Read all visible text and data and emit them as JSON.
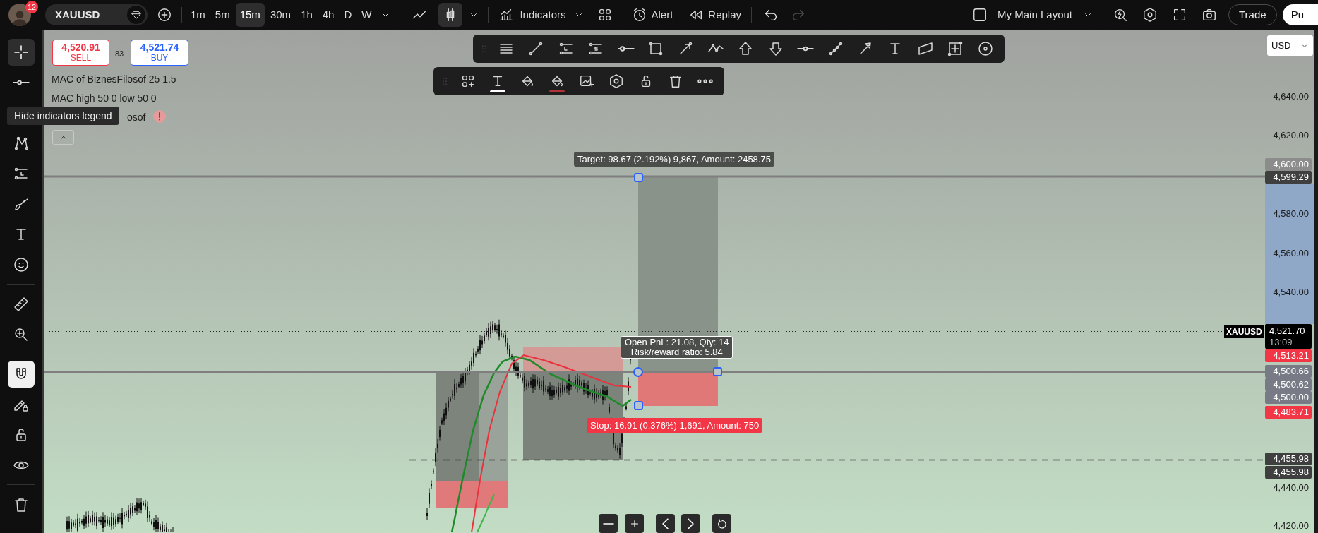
{
  "top_bar": {
    "notification_count": "12",
    "symbol": "XAUUSD",
    "timeframes": [
      {
        "label": "1m",
        "selected": false
      },
      {
        "label": "5m",
        "selected": false
      },
      {
        "label": "15m",
        "selected": true
      },
      {
        "label": "30m",
        "selected": false
      },
      {
        "label": "1h",
        "selected": false
      },
      {
        "label": "4h",
        "selected": false
      },
      {
        "label": "D",
        "selected": false
      },
      {
        "label": "W",
        "selected": false
      }
    ],
    "chart_types": [
      {
        "selected": false
      },
      {
        "selected": true
      }
    ],
    "indicators": "Indicators",
    "alert": "Alert",
    "replay": "Replay",
    "history": [
      {
        "disabled": false
      },
      {
        "disabled": true
      }
    ],
    "layout": "My Main Layout",
    "trade": "Trade",
    "publish": "Pu"
  },
  "left_toolbar": [
    {
      "selected": true
    },
    {
      "selected": false
    },
    {
      "selected": false
    },
    {
      "selected": false
    },
    {
      "selected": false
    },
    {
      "selected": false
    },
    {
      "selected": false
    },
    {
      "selected": false
    },
    {
      "selected": false
    },
    {
      "selected": true
    },
    {
      "selected": false
    },
    {
      "selected": false
    },
    {
      "selected": false
    },
    {
      "selected": false
    }
  ],
  "trade_panel": {
    "sell_price": "4,520.91",
    "sell_label": "SELL",
    "spread": "83",
    "buy_price": "4,521.74",
    "buy_label": "BUY"
  },
  "legend": {
    "lines": [
      "MAC of BiznesFilosof 25 1.5",
      "MAC high 50 0 low 50 0",
      "osof"
    ],
    "tooltip": "Hide indicators legend"
  },
  "position": {
    "target": "Target: 98.67 (2.192%) 9,867, Amount: 2458.75",
    "open_pnl": "Open PnL: 21.08, Qty: 14",
    "risk_reward": "Risk/reward ratio: 5.84",
    "stop": "Stop: 16.91 (0.376%) 1,691, Amount: 750"
  },
  "price_axis": {
    "currency": "USD",
    "ticks": [
      "4,640.00",
      "4,620.00",
      "4,580.00",
      "4,560.00",
      "4,540.00",
      "4,440.00",
      "4,420.00"
    ],
    "symbol_tag": "XAUUSD",
    "last_price": "4,521.70",
    "countdown": "13:09",
    "labels": [
      {
        "text": "4,600.00",
        "color": "#8c8c8c"
      },
      {
        "text": "4,599.29",
        "color": "#3f3f3f"
      },
      {
        "text": "4,513.21",
        "color": "#f23645"
      },
      {
        "text": "4,500.66",
        "color": "#787b86"
      },
      {
        "text": "4,500.62",
        "color": "#787b86"
      },
      {
        "text": "4,500.00",
        "color": "#787b86"
      },
      {
        "text": "4,483.71",
        "color": "#f23645"
      },
      {
        "text": "4,455.98",
        "color": "#3f3f3f"
      },
      {
        "text": "4,455.98",
        "color": "#3f3f3f"
      }
    ]
  }
}
